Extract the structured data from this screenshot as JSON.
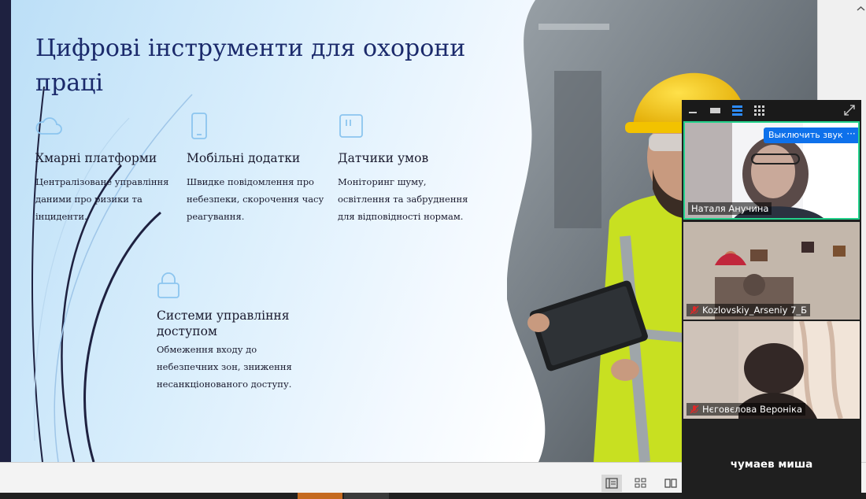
{
  "slide": {
    "title": "Цифрові інструменти для охорони праці",
    "features": [
      {
        "icon": "cloud-icon",
        "title": "Хмарні платформи",
        "desc": "Централізоване управління даними про ризики та інциденти."
      },
      {
        "icon": "smartphone-icon",
        "title": "Мобільні додатки",
        "desc": "Швидке повідомлення про небезпеки, скорочення часу реагування."
      },
      {
        "icon": "sensor-icon",
        "title": "Датчики умов",
        "desc": "Моніторинг шуму, освітлення та забруднення для відповідності нормам."
      },
      {
        "icon": "lock-icon",
        "title": "Системи управління доступом",
        "desc": "Обмеження входу до небезпечних зон, зниження несанкціонованого доступу."
      }
    ],
    "photo_subject": "worker in hard hat with tablet"
  },
  "video_panel": {
    "toolbar_icons": [
      "minimize-icon",
      "thumbnail-view-icon",
      "speaker-view-icon",
      "gallery-view-icon",
      "expand-icon"
    ],
    "participants": [
      {
        "name": "Наталя Анучина",
        "muted": false,
        "active_speaker": true
      },
      {
        "name": "Kozlovskiy_Arseniy 7_Б",
        "muted": true
      },
      {
        "name": "Нєговєлова Вероніка",
        "muted": true
      }
    ],
    "unmute_label": "Выключить звук",
    "more_label": "···",
    "avatar_only_name": "чумаев миша"
  },
  "statusbar": {
    "view_buttons": [
      "normal-view-icon",
      "slide-sorter-icon",
      "reading-view-icon"
    ]
  },
  "colors": {
    "title": "#1b2a6b",
    "icon_accent": "#8cc5ef",
    "active_speaker_border": "#23d18b",
    "button_blue": "#0e71eb"
  }
}
